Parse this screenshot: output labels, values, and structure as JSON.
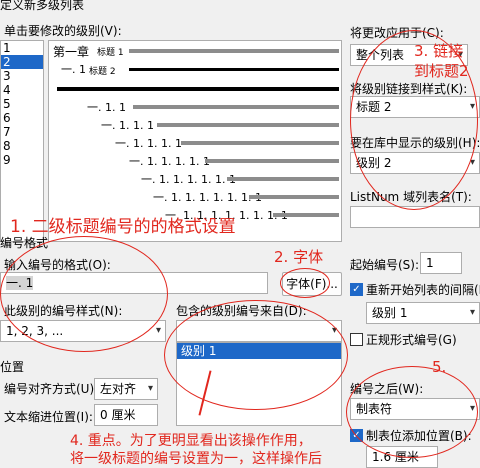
{
  "title": "定义新多级列表",
  "labels": {
    "click_level": "单击要修改的级别(V):",
    "apply_to": "将更改应用于(C):",
    "link_style": "将级别链接到样式(K):",
    "gallery_level": "要在库中显示的级别(H):",
    "listnum": "ListNum 域列表名(T):",
    "number_format_section": "编号格式",
    "enter_format": "输入编号的格式(O):",
    "font_button": "字体(F)...",
    "number_style": "此级别的编号样式(N):",
    "include_from": "包含的级别编号来自(D):",
    "start_at": "起始编号(S):",
    "restart": "重新开始列表的间隔(R):",
    "legal": "正规形式编号(G)",
    "position_section": "位置",
    "alignment": "编号对齐方式(U):",
    "text_indent": "文本缩进位置(I):",
    "follow_with": "编号之后(W):",
    "add_tab": "制表位添加位置(B):"
  },
  "levels": [
    "1",
    "2",
    "3",
    "4",
    "5",
    "6",
    "7",
    "8",
    "9"
  ],
  "selected_level": "2",
  "preview": {
    "line1_num": "第一章",
    "line1_style": "标题 1",
    "line2_num": "一. 1",
    "line2_style": "标题 2",
    "rows": [
      "一. 1. 1",
      "一. 1. 1. 1",
      "一. 1. 1. 1. 1",
      "一. 1. 1. 1. 1. 1",
      "一. 1. 1. 1. 1. 1. 1",
      "一. 1. 1. 1. 1. 1. 1. 1",
      "一. 1. 1. 1. 1. 1. 1. 1. 1"
    ]
  },
  "values": {
    "apply_to": "整个列表",
    "link_style": "标题 2",
    "gallery_level": "级别 2",
    "format_text": "一. 1",
    "number_style": "1, 2, 3, ...",
    "include_from": "",
    "include_option": "级别 1",
    "start_at": "1",
    "restart_level": "级别 1",
    "alignment": "左对齐",
    "text_indent": "0 厘米",
    "follow_with": "制表符",
    "tab_pos": "1.6 厘米"
  },
  "annotations": {
    "a1": "1. 二级标题编号的的格式设置",
    "a2": "2. 字体",
    "a3_line1": "3. 链接",
    "a3_line2": "到标题2",
    "a4_line1": "4. 重点。为了更明显看出该操作作用，",
    "a4_line2": "将一级标题的编号设置为一，这样操作后",
    "a5": "5."
  },
  "colors": {
    "annotation": "#e1271e",
    "accent": "#1e68c8"
  }
}
